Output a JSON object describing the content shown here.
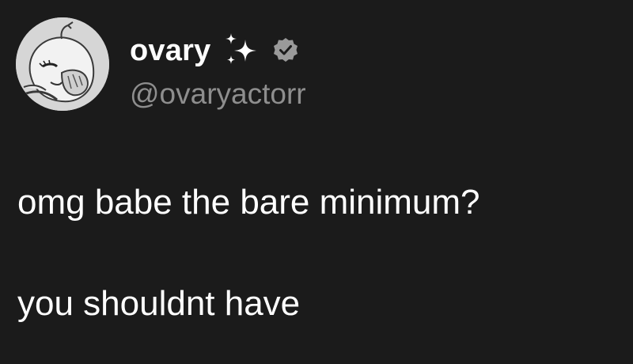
{
  "tweet": {
    "author": {
      "display_name": "ovary",
      "handle": "@ovaryactorr",
      "name_emoji_icon": "sparkles-icon",
      "verified_icon": "verified-badge-icon"
    },
    "text_lines": [
      "omg babe the bare minimum?",
      "you shouldnt have"
    ]
  },
  "colors": {
    "background": "#1b1b1b",
    "text": "#ffffff",
    "handle": "#8e8e8e",
    "verified_badge": "#9a9a9a"
  }
}
